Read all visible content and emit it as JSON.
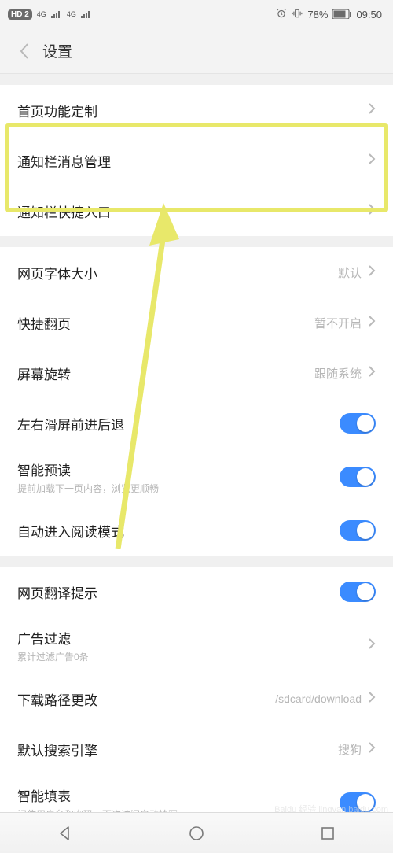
{
  "status": {
    "hd_badge": "HD 2",
    "net_label": "4G",
    "alarm": "⏰",
    "vibrate": "📳",
    "battery_pct": "78%",
    "time": "09:50"
  },
  "header": {
    "page_title": "设置"
  },
  "sections": {
    "group1": {
      "home_customize": "首页功能定制",
      "notif_mgmt": "通知栏消息管理",
      "notif_shortcut": "通知栏快捷入口"
    },
    "group2": {
      "font_size": "网页字体大小",
      "font_size_value": "默认",
      "quick_flip": "快捷翻页",
      "quick_flip_value": "暂不开启",
      "rotate": "屏幕旋转",
      "rotate_value": "跟随系统",
      "swipe_nav": "左右滑屏前进后退",
      "preload": "智能预读",
      "preload_sub": "提前加载下一页内容，浏览更顺畅",
      "auto_read": "自动进入阅读模式"
    },
    "group3": {
      "translate_hint": "网页翻译提示",
      "ad_filter": "广告过滤",
      "ad_filter_sub": "累计过滤广告0条",
      "download_path": "下载路径更改",
      "download_path_value": "/sdcard/download",
      "search_engine": "默认搜索引擎",
      "search_engine_value": "搜狗",
      "smart_fill": "智能填表",
      "smart_fill_sub": "记住用户名和密码，下次访问自动填写。"
    }
  },
  "watermark": "Baidu 经验 jingyan.baidu.com"
}
